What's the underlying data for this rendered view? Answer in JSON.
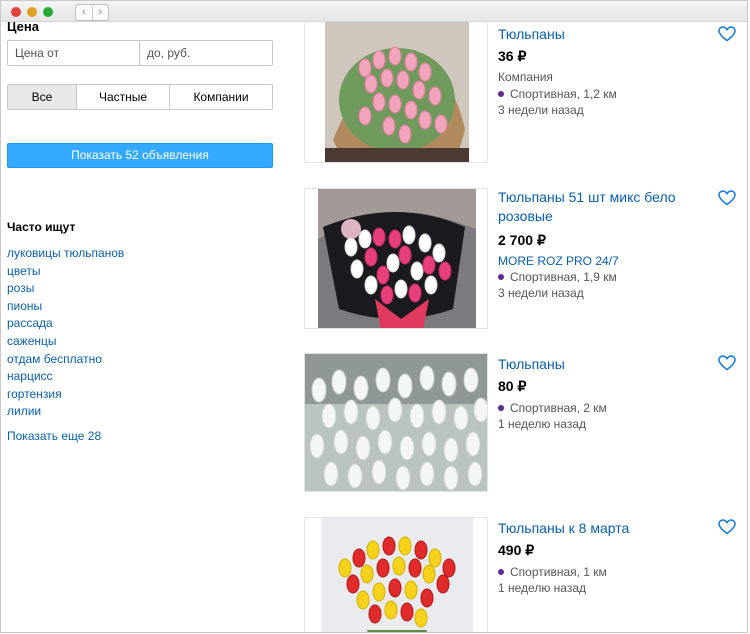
{
  "window": {
    "controls": [
      "close",
      "minimize",
      "maximize"
    ],
    "nav": {
      "back": "‹",
      "forward": "›"
    }
  },
  "filters": {
    "price_title": "Цена",
    "price_from_placeholder": "Цена от",
    "price_to_placeholder": "до, руб.",
    "seller_types": [
      "Все",
      "Частные",
      "Компании"
    ],
    "selected_seller_type": "Все",
    "show_button": "Показать 52 объявления"
  },
  "popular": {
    "title": "Часто ищут",
    "links": [
      "луковицы тюльпанов",
      "цветы",
      "розы",
      "пионы",
      "рассада",
      "саженцы",
      "отдам бесплатно",
      "нарцисс",
      "гортензия",
      "лилии"
    ],
    "show_more": "Показать еще 28"
  },
  "listings": [
    {
      "title": "Тюльпаны",
      "price": "36",
      "currency": "₽",
      "seller": "Компания",
      "location": "Спортивная, 1,2 км",
      "age": "3 недели назад",
      "photo": "pink tulip bouquet"
    },
    {
      "title": "Тюльпаны 51 шт микс бело розовые",
      "price": "2 700",
      "currency": "₽",
      "seller": "MORE ROZ PRO 24/7",
      "location": "Спортивная, 1,9 км",
      "age": "3 недели назад",
      "photo": "white and pink tulip bouquet"
    },
    {
      "title": "Тюльпаны",
      "price": "80",
      "currency": "₽",
      "seller": "",
      "location": "Спортивная, 2 км",
      "age": "1 неделю назад",
      "photo": "white tulips"
    },
    {
      "title": "Тюльпаны к 8 марта",
      "price": "490",
      "currency": "₽",
      "seller": "",
      "location": "Спортивная, 1 км",
      "age": "1 неделю назад",
      "photo": "red and yellow tulip bouquet"
    }
  ],
  "colors": {
    "accent": "#34aaff",
    "link": "#0a5fa8",
    "metro": "#5b2d90"
  }
}
